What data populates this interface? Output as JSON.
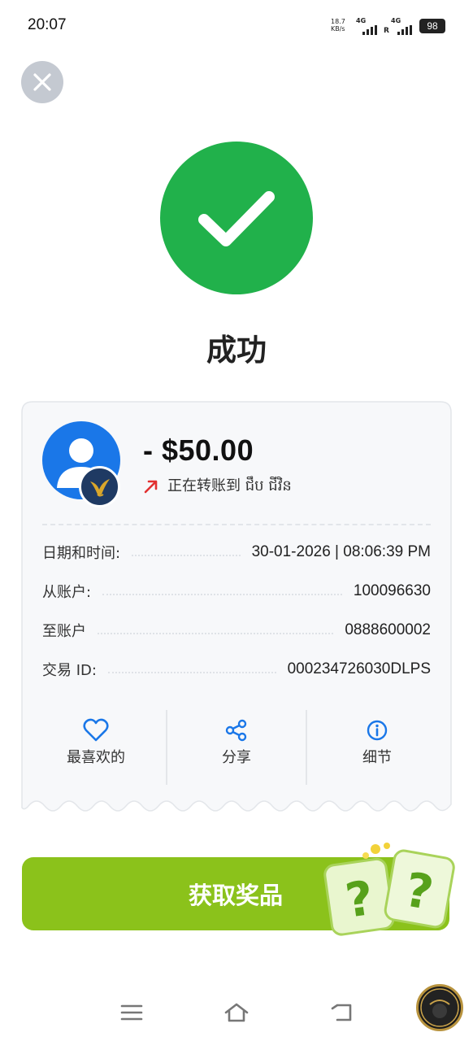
{
  "status_bar": {
    "time": "20:07",
    "net_speed_value": "18.7",
    "net_speed_unit": "KB/s",
    "sim1_label": "4G",
    "sim2_label": "4G",
    "roaming": "R",
    "battery": "98"
  },
  "success": {
    "title": "成功",
    "icon": "checkmark-icon",
    "color": "#21b14b"
  },
  "transaction": {
    "amount": "- $50.00",
    "transfer_text": "正在转账到 ជឹប ជីវិន",
    "rows": [
      {
        "label": "日期和时间:",
        "value": "30-01-2026 | 08:06:39 PM"
      },
      {
        "label": "从账户:",
        "value": "100096630"
      },
      {
        "label": "至账户",
        "value": "0888600002"
      },
      {
        "label": "交易 ID:",
        "value": "000234726030DLPS"
      }
    ]
  },
  "actions": [
    {
      "label": "最喜欢的",
      "icon": "heart-icon"
    },
    {
      "label": "分享",
      "icon": "share-icon"
    },
    {
      "label": "细节",
      "icon": "info-icon"
    }
  ],
  "reward": {
    "label": "获取奖品",
    "color": "#8bc21b"
  },
  "nav_bar": {
    "icons": [
      "menu-icon",
      "home-icon",
      "back-icon"
    ]
  },
  "colors": {
    "accent_blue": "#1a77e8",
    "arrow_red": "#e23030"
  }
}
